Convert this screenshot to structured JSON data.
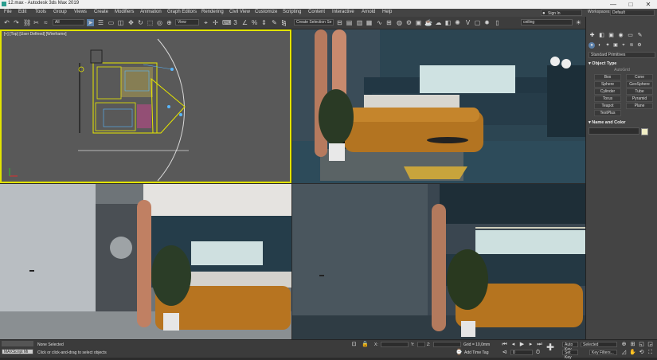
{
  "window": {
    "title": "12.max - Autodesk 3ds Max 2019",
    "controls": [
      "—",
      "□",
      "✕"
    ]
  },
  "menu": [
    "File",
    "Edit",
    "Tools",
    "Group",
    "Views",
    "Create",
    "Modifiers",
    "Animation",
    "Graph Editors",
    "Rendering",
    "Civil View",
    "Customize",
    "Scripting",
    "Content",
    "Interactive",
    "Arnold",
    "Help"
  ],
  "signin": {
    "label": "Sign In",
    "icon": "user-icon"
  },
  "workspace": {
    "label": "Workspaces:",
    "value": "Default"
  },
  "toolbar": {
    "filter": "All",
    "ref_coord": "View",
    "selection_set": "Create Selection Se",
    "named": "ceiling"
  },
  "command_panel": {
    "dropdown": "Standard Primitives",
    "object_type": {
      "title": "Object Type",
      "autogrid": "AutoGrid",
      "buttons": [
        "Box",
        "Cone",
        "Sphere",
        "GeoSphere",
        "Cylinder",
        "Tube",
        "Torus",
        "Pyramid",
        "Teapot",
        "Plane",
        "TextPlus"
      ]
    },
    "name_color": {
      "title": "Name and Color"
    },
    "colors": {
      "swatch": "#f2efc6"
    }
  },
  "viewports": {
    "top_label": "[+] [Top] [User Defined] [Wireframe]",
    "active_border": "#e2e400"
  },
  "status": {
    "selection": "None Selected",
    "prompt": "Click or click-and-drag to select objects",
    "maxscript": "MAXScript Mi",
    "x_label": "X:",
    "y_label": "Y:",
    "z_label": "Z:",
    "grid": "Grid = 10,0mm",
    "add_time_tag": "Add Time Tag",
    "auto_key": "Auto Key",
    "set_key": "Set Key",
    "selected": "Selected",
    "key_filters": "Key Filters...",
    "frame": "0"
  }
}
